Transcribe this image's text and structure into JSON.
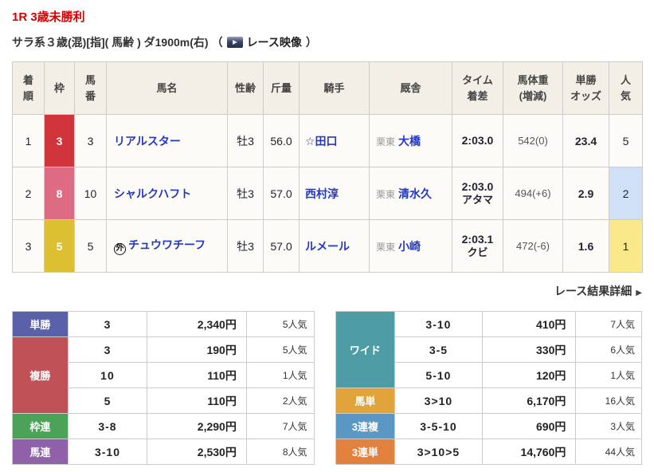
{
  "page": {
    "title": "1R 3歳未勝利",
    "conditions": "サラ系３歳(混)[指]( 馬齢 ) ダ1900m(右)",
    "video_open": "（ ",
    "video_label": "レース映像",
    "video_close": " ）",
    "detail_link": "レース結果詳細",
    "detail_arrow": "▶",
    "title_color": "#d50000"
  },
  "results_table": {
    "headers": {
      "rank": "着\n順",
      "bracket": "枠",
      "number": "馬\n番",
      "name": "馬名",
      "sexage": "性齢",
      "weight": "斤量",
      "jockey": "騎手",
      "stable": "厩舎",
      "time": "タイム\n着差",
      "body": "馬体重\n(増減)",
      "odds": "単勝\nオッズ",
      "pop": "人\n気"
    },
    "rows": [
      {
        "rank": "1",
        "bracket": "3",
        "bracket_bg": "#d0353c",
        "number": "3",
        "mark": "",
        "name": "リアルスター",
        "sexage": "牡3",
        "weight": "56.0",
        "jockey": "☆田口",
        "stable_region": "栗東",
        "stable": "大橋",
        "time": "2:03.0",
        "margin": "",
        "body": "542(0)",
        "odds": "23.4",
        "pop": "5",
        "pop_bg": ""
      },
      {
        "rank": "2",
        "bracket": "8",
        "bracket_bg": "#dd6b83",
        "number": "10",
        "mark": "",
        "name": "シャルクハフト",
        "sexage": "牡3",
        "weight": "57.0",
        "jockey": "西村淳",
        "stable_region": "栗東",
        "stable": "清水久",
        "time": "2:03.0",
        "margin": "アタマ",
        "body": "494(+6)",
        "odds": "2.9",
        "pop": "2",
        "pop_bg": "#cfe0f7"
      },
      {
        "rank": "3",
        "bracket": "5",
        "bracket_bg": "#dcc031",
        "number": "5",
        "mark": "外",
        "name": "チュウワチーフ",
        "sexage": "牡3",
        "weight": "57.0",
        "jockey": "ルメール",
        "stable_region": "栗東",
        "stable": "小崎",
        "time": "2:03.1",
        "margin": "クビ",
        "body": "472(-6)",
        "odds": "1.6",
        "pop": "1",
        "pop_bg": "#f9e98a"
      }
    ]
  },
  "payouts": {
    "left": [
      {
        "type": "単勝",
        "color": "#5a61a9",
        "rows": [
          {
            "combo": "3",
            "payout": "2,340円",
            "pop": "5人気"
          }
        ]
      },
      {
        "type": "複勝",
        "color": "#c05157",
        "rows": [
          {
            "combo": "3",
            "payout": "190円",
            "pop": "5人気"
          },
          {
            "combo": "10",
            "payout": "110円",
            "pop": "1人気"
          },
          {
            "combo": "5",
            "payout": "110円",
            "pop": "2人気"
          }
        ]
      },
      {
        "type": "枠連",
        "color": "#4aa356",
        "rows": [
          {
            "combo": "3-8",
            "payout": "2,290円",
            "pop": "7人気"
          }
        ]
      },
      {
        "type": "馬連",
        "color": "#8e61a9",
        "rows": [
          {
            "combo": "3-10",
            "payout": "2,530円",
            "pop": "8人気"
          }
        ]
      }
    ],
    "right": [
      {
        "type": "ワイド",
        "color": "#4e9da5",
        "rows": [
          {
            "combo": "3-10",
            "payout": "410円",
            "pop": "7人気"
          },
          {
            "combo": "3-5",
            "payout": "330円",
            "pop": "6人気"
          },
          {
            "combo": "5-10",
            "payout": "120円",
            "pop": "1人気"
          }
        ]
      },
      {
        "type": "馬単",
        "color": "#e0a43a",
        "rows": [
          {
            "combo": "3>10",
            "payout": "6,170円",
            "pop": "16人気"
          }
        ]
      },
      {
        "type": "3連複",
        "color": "#5b97c3",
        "rows": [
          {
            "combo": "3-5-10",
            "payout": "690円",
            "pop": "3人気"
          }
        ]
      },
      {
        "type": "3連単",
        "color": "#e2803e",
        "rows": [
          {
            "combo": "3>10>5",
            "payout": "14,760円",
            "pop": "44人気"
          }
        ]
      }
    ]
  }
}
